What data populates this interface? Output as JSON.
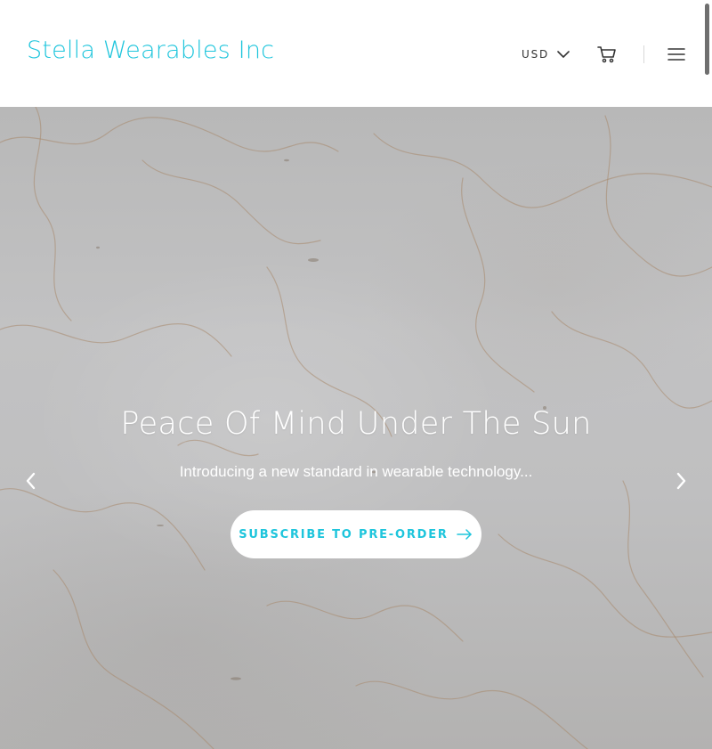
{
  "header": {
    "brand": "Stella Wearables Inc",
    "currency": "USD",
    "icons": {
      "currency_dropdown": "chevron-down-icon",
      "cart": "cart-icon",
      "menu": "hamburger-menu-icon"
    }
  },
  "hero": {
    "title": "Peace Of Mind Under The Sun",
    "subtitle": "Introducing a new standard in wearable technology...",
    "cta_label": "SUBSCRIBE TO PRE-ORDER",
    "icons": {
      "cta": "arrow-right-icon",
      "prev": "chevron-left-icon",
      "next": "chevron-right-icon"
    }
  },
  "colors": {
    "accent": "#1ec5dc",
    "header_bg": "#ffffff",
    "hero_text": "#ffffff"
  }
}
